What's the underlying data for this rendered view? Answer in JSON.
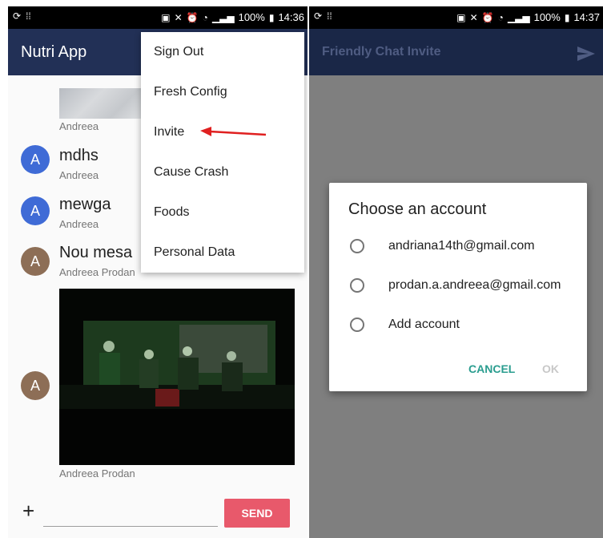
{
  "left": {
    "status": {
      "battery": "100%",
      "time": "14:36"
    },
    "appbar": {
      "title": "Nutri App"
    },
    "messages": [
      {
        "sender": "Andreea"
      },
      {
        "text": "mdhs",
        "sender": "Andreea",
        "avatar": "A"
      },
      {
        "text": "mewga",
        "sender": "Andreea",
        "avatar": "A"
      },
      {
        "text": "Nou mesa",
        "sender": "Andreea Prodan",
        "avatar": "A"
      },
      {
        "sender": "Andreea Prodan",
        "avatar": "A"
      }
    ],
    "menu": {
      "items": [
        "Sign Out",
        "Fresh Config",
        "Invite",
        "Cause Crash",
        "Foods",
        "Personal Data"
      ]
    },
    "composer": {
      "plus": "+",
      "value": "",
      "send_label": "SEND"
    }
  },
  "right": {
    "status": {
      "battery": "100%",
      "time": "14:37"
    },
    "appbar": {
      "title": "Friendly Chat Invite"
    },
    "dialog": {
      "title": "Choose an account",
      "options": [
        "andriana14th@gmail.com",
        "prodan.a.andreea@gmail.com",
        "Add account"
      ],
      "cancel_label": "CANCEL",
      "ok_label": "OK"
    }
  },
  "colors": {
    "appbar": "#223056",
    "send_button": "#e8596b",
    "avatar_blue": "#3f6bd6",
    "avatar_brown": "#8d6e56",
    "dialog_action": "#2a9d8f",
    "arrow": "#e02020"
  }
}
